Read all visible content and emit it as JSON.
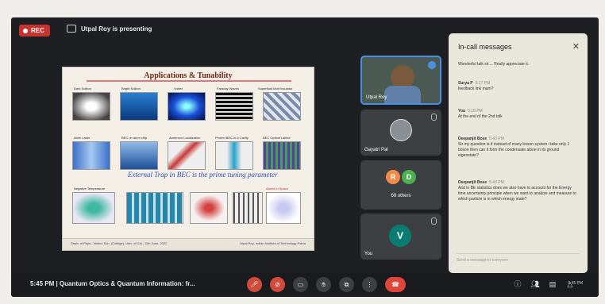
{
  "topbar": {
    "rec_label": "REC",
    "presenter_text": "Utpal Roy is presenting"
  },
  "slide": {
    "title": "Applications & Tunability",
    "row1": [
      "Dark Soliton",
      "Bright Soliton",
      "Vortex",
      "Faraday Waves",
      "Superfluid Mott Insulator"
    ],
    "row2": [
      "Atom Laser",
      "BEC on atom chip",
      "Anderson Localization",
      "Photon BEC in a Cavity",
      "BEC Optical Lattice"
    ],
    "row3": [
      "Negative Temperature",
      "",
      "",
      "",
      "Atoms in Space"
    ],
    "note": "External Trap in BEC is the prime tuning parameter",
    "footer_left": "Deptt. of Phys., Vishnu Sch. (College), Univ. of Cal., 11th June, 2022",
    "footer_right": "Utpal Roy, Indian Institute of Technology Patna"
  },
  "tiles": {
    "self_name": "Utpal Roy",
    "gayatri": "Gayatri Pal",
    "others_label": "69 others",
    "others_avatars": [
      "R",
      "D"
    ],
    "you_label": "You",
    "you_avatar": "V"
  },
  "chat": {
    "header": "In-call messages",
    "messages": [
      {
        "name": "",
        "time": "",
        "text": "Wonderful talk sir.... Really appreciate it."
      },
      {
        "name": "Surya P",
        "time": "5:17 PM",
        "text": "feedback link mam?"
      },
      {
        "name": "You",
        "time": "5:18 PM",
        "text": "At the end of the 2nd talk"
      },
      {
        "name": "Deepanjit Bose",
        "time": "5:43 PM",
        "text": "Sir my question is if instead of many boson system i take only 1 boson then can it form the condensate alone in its ground eigenstate?"
      },
      {
        "name": "Deepanjit Bose",
        "time": "5:43 PM",
        "text": "And in BE statistics does we also have to account for the Energy time uncertainty principle when we want to analyze and measure to which particle is in which energy state?"
      }
    ],
    "input_placeholder": "Send a message to everyone"
  },
  "bottom": {
    "time_text": "5:45 PM  |  Quantum Optics & Quantum Information: fr...",
    "clock": "5:45 PM"
  },
  "colors": {
    "rec": "#c5342e",
    "end_call": "#e0453a",
    "self_border": "#4a90e2"
  }
}
